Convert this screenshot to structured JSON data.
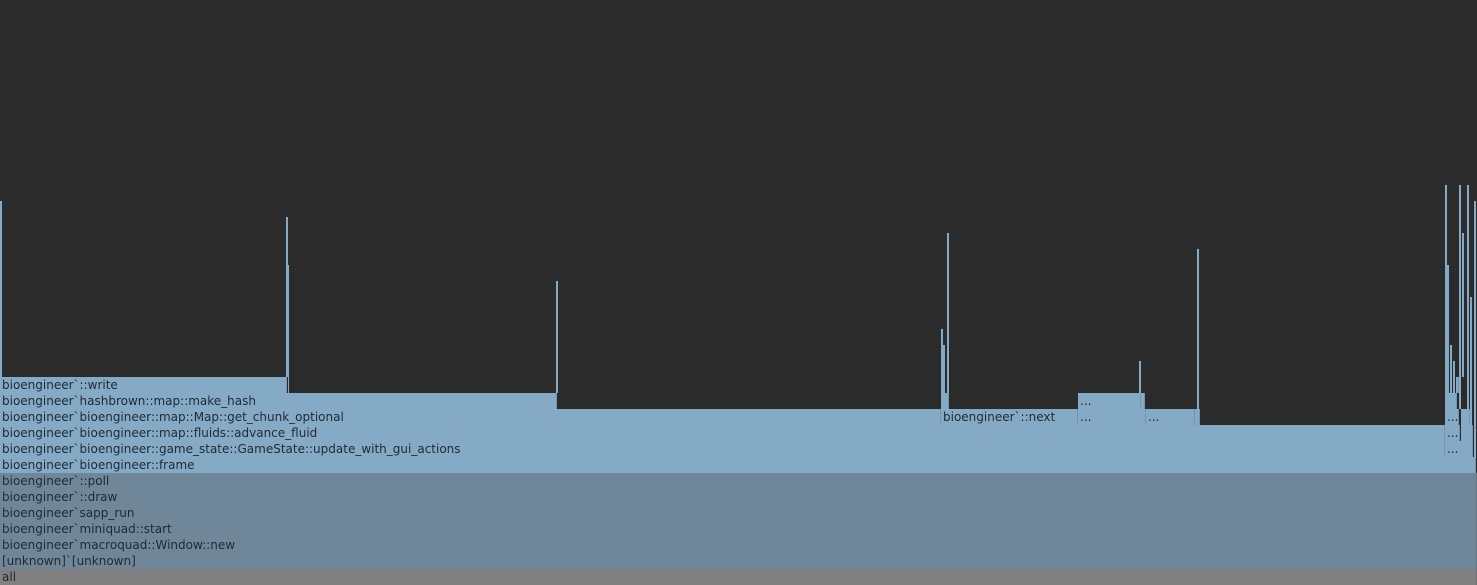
{
  "flamegraph": {
    "frames": {
      "all": "all",
      "unknown": "[unknown]`[unknown]",
      "window_new": "bioengineer`macroquad::Window::new",
      "miniquad_start": "bioengineer`miniquad::start",
      "sapp_run": "bioengineer`sapp_run",
      "draw": "bioengineer`::draw",
      "poll": "bioengineer`::poll",
      "frame": "bioengineer`bioengineer::frame",
      "update_gui": "bioengineer`bioengineer::game_state::GameState::update_with_gui_actions",
      "advance_fluid": "bioengineer`bioengineer::map::fluids::advance_fluid",
      "get_chunk": "bioengineer`bioengineer::map::Map::get_chunk_optional",
      "next": "bioengineer`::next",
      "make_hash": "bioengineer`hashbrown::map::make_hash",
      "write": "bioengineer`::write",
      "ellipsis": "..."
    },
    "colors": {
      "background": "#2b2b2b",
      "hot_frame": "#85aac6",
      "warm_frame": "#6f8799",
      "root_frame": "#808080"
    }
  }
}
